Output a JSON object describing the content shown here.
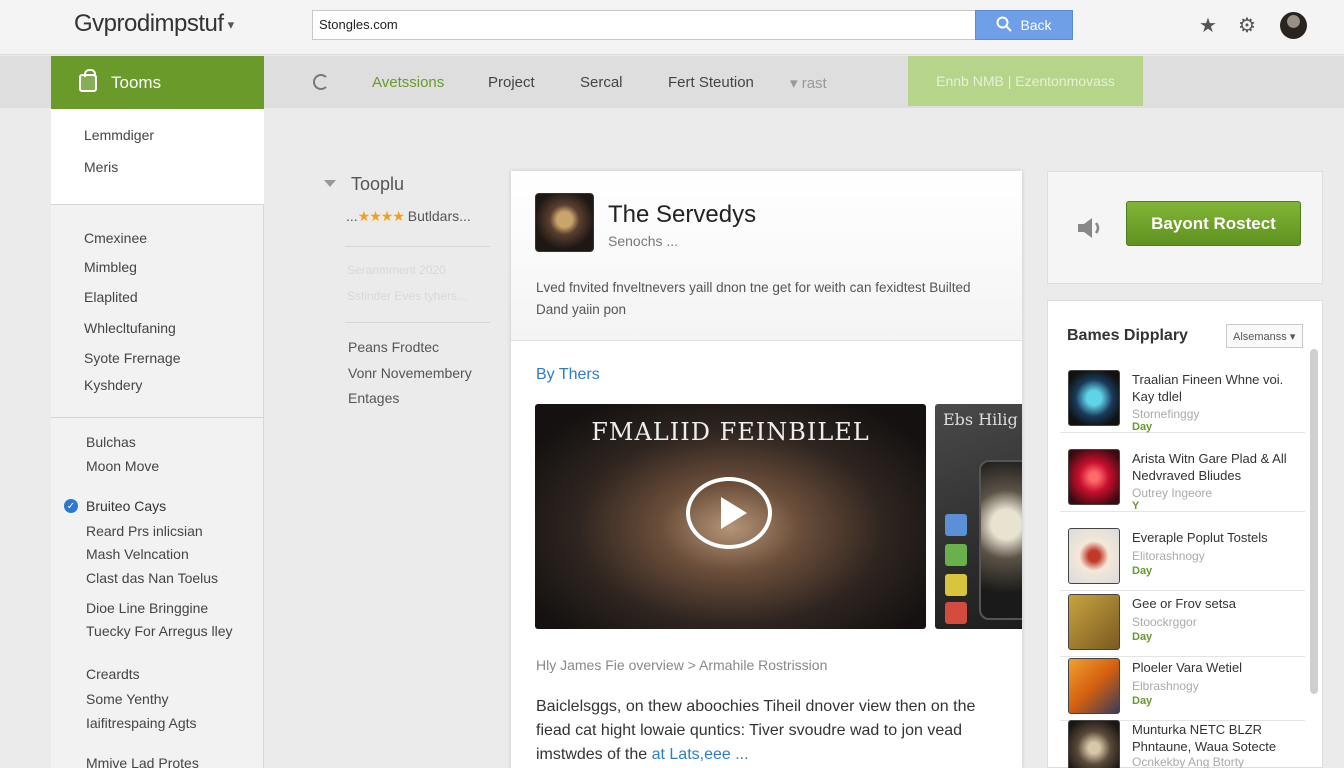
{
  "header": {
    "logo_text": "Gvprodimpstuf",
    "search_value": "Stongles.com",
    "search_button": "Back",
    "icons": [
      "star-icon",
      "gear-icon",
      "avatar"
    ]
  },
  "nav": {
    "active_tab": "Tooms",
    "items": [
      "Avetssions",
      "Project",
      "Sercal",
      "Fert Steution",
      "rast"
    ],
    "cta_label": "Ennb NMB | Ezentonmovass"
  },
  "sidebar": {
    "top_items": [
      "Lemmdiger",
      "Meris"
    ],
    "group1": [
      "Cmexinee",
      "Mimbleg",
      "Elaplited",
      "Whlecltufaning",
      "Syote Frernage",
      "Kyshdery"
    ],
    "group2": [
      "Bulchas",
      "Moon Move"
    ],
    "group3_header": "Bruiteo Cays",
    "group3": [
      "Reard Prs inlicsian",
      "Mash Velncation",
      "Clast das Nan Toelus",
      "Dioe Line Bringgine",
      "Tuecky For Arregus lley"
    ],
    "group4": [
      "Creardts",
      "Some Yenthy",
      "Iaifitrespaing Agts"
    ],
    "group5": [
      "Mmive Lad Protes"
    ]
  },
  "middle": {
    "section_title": "Tooplu",
    "rating_prefix": "...",
    "rating_stars": "★★★★",
    "rating_label": "Butldars...",
    "faded_line1": "Seranmment 2020",
    "faded_line2": "Sstinder Eves tyhers...",
    "links": [
      "Peans Frodtec",
      "Vonr Novemembery",
      "Entages"
    ]
  },
  "card": {
    "title": "The Servedys",
    "subtitle": "Senochs ...",
    "description": "Lved fnvited fnveltnevers yaill dnon tne get for weith can fexidtest Builted Dand yaiin pon",
    "by_link": "By Thers",
    "video_title": "FMALIID FEINBILEL",
    "shot_text": "Ebs Hilig",
    "breadcrumb": "Hly James Fie overview   >  Armahile Rostrission",
    "body_text": "Baiclelsggs, on thew aboochies Tiheil dnover view then on the fiead cat hight lowaie quntics: Tiver svoudre wad to jon vead imstwdes of the",
    "body_link": "at Lats,eee ..."
  },
  "right": {
    "buy_button": "Bayont Rostect",
    "list_title": "Bames Dipplary",
    "list_select": "Alsemanss",
    "items": [
      {
        "title": "Traalian Fineen Whne voi. Kay tdlel",
        "sub": "Stornefinggy",
        "price": "Day"
      },
      {
        "title": "Arista Witn Gare Plad & All Nedvraved Bliudes",
        "sub": "Outrey Ingeore",
        "price": "Y"
      },
      {
        "title": "Everaple Poplut Tostels",
        "sub": "Elitorashnogy",
        "price": "Day"
      },
      {
        "title": "Gee or Frov setsa",
        "sub": "Stoockrggor",
        "price": "Day"
      },
      {
        "title": "Ploeler Vara Wetiel",
        "sub": "Elbrashnogy",
        "price": "Day"
      },
      {
        "title": "Munturka NETC BLZR Phntaune, Waua Sotecte",
        "sub": "Ocnkekby Ang Btorty",
        "price": ""
      }
    ]
  },
  "colors": {
    "accent_green": "#6a9a2a",
    "link_blue": "#2f7cc7",
    "search_button_blue": "#6f9fe6"
  }
}
